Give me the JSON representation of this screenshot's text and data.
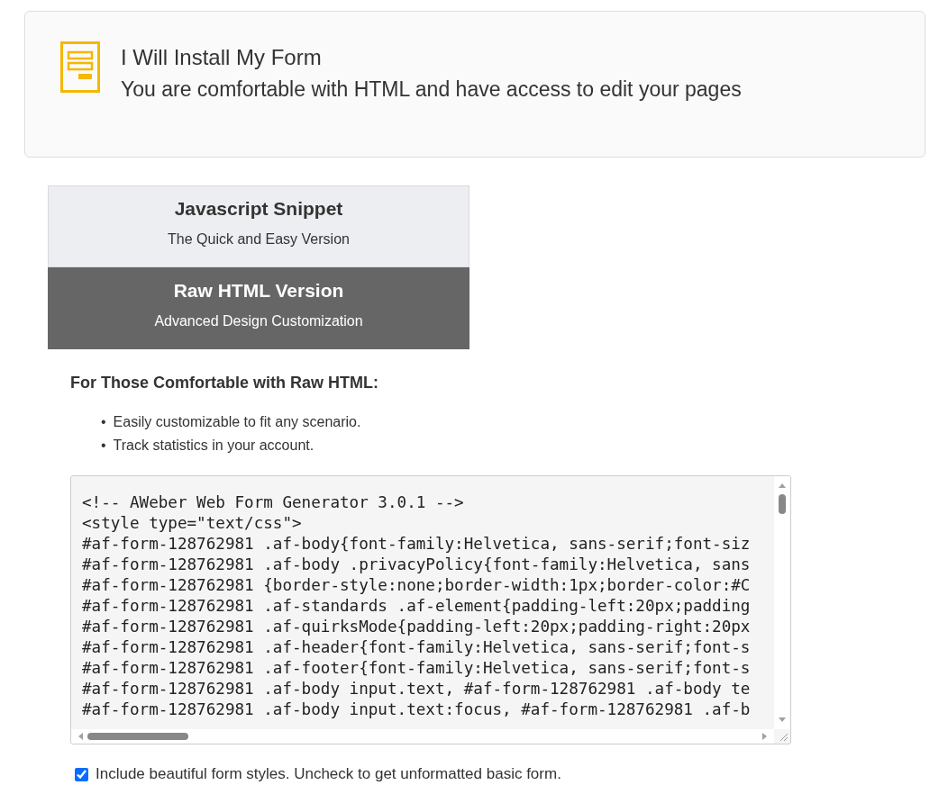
{
  "install_card": {
    "title": "I Will Install My Form",
    "subtitle": "You are comfortable with HTML and have access to edit your pages"
  },
  "options": [
    {
      "title": "Javascript Snippet",
      "subtitle": "The Quick and Easy Version",
      "selected": false
    },
    {
      "title": "Raw HTML Version",
      "subtitle": "Advanced Design Customization",
      "selected": true
    }
  ],
  "heading": "For Those Comfortable with Raw HTML:",
  "bullets": [
    {
      "marker": "•",
      "text": "Easily customizable to fit any scenario."
    },
    {
      "marker": "•",
      "text": "Track statistics in your account."
    }
  ],
  "code_lines": [
    "<!-- AWeber Web Form Generator 3.0.1 -->",
    "<style type=\"text/css\">",
    "#af-form-128762981 .af-body{font-family:Helvetica, sans-serif;font-siz",
    "#af-form-128762981 .af-body .privacyPolicy{font-family:Helvetica, sans",
    "#af-form-128762981 {border-style:none;border-width:1px;border-color:#C",
    "#af-form-128762981 .af-standards .af-element{padding-left:20px;padding",
    "#af-form-128762981 .af-quirksMode{padding-left:20px;padding-right:20px",
    "#af-form-128762981 .af-header{font-family:Helvetica, sans-serif;font-s",
    "#af-form-128762981 .af-footer{font-family:Helvetica, sans-serif;font-s",
    "#af-form-128762981 .af-body input.text, #af-form-128762981 .af-body te",
    "#af-form-128762981 .af-body input.text:focus, #af-form-128762981 .af-b"
  ],
  "styles_checkbox": {
    "label": "Include beautiful form styles. Uncheck to get unformatted basic form.",
    "checked": true
  }
}
